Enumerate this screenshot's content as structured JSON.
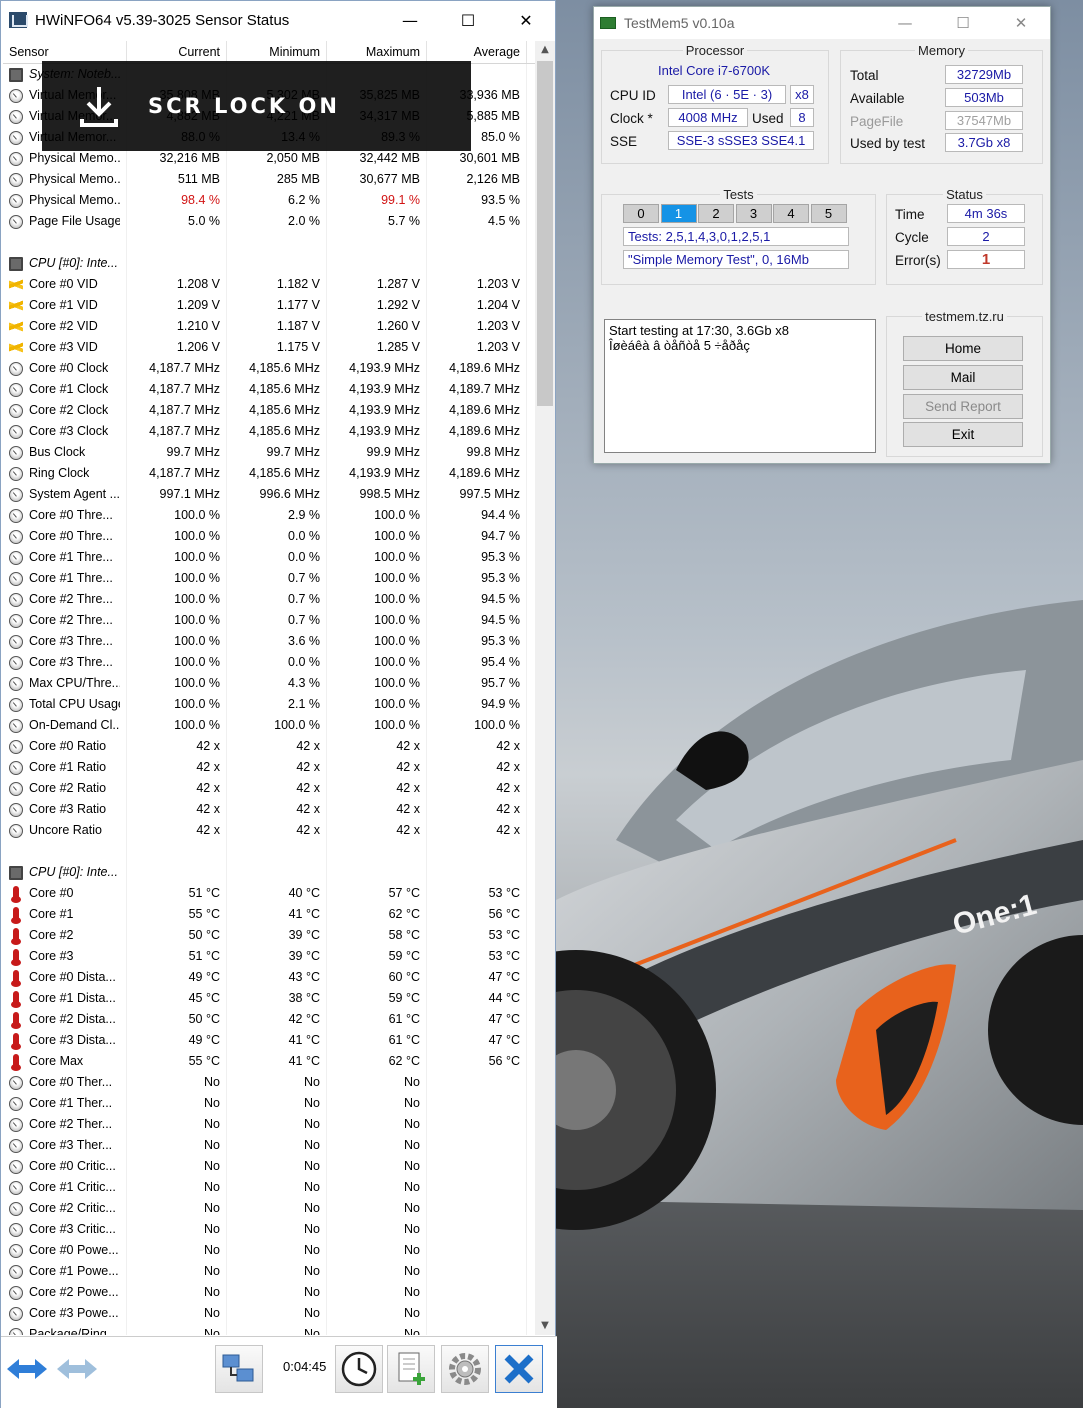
{
  "hwinfo": {
    "title": "HWiNFO64 v5.39-3025 Sensor Status",
    "window_buttons": {
      "minimize": "—",
      "maximize": "☐",
      "close": "✕"
    },
    "columns": [
      "Sensor",
      "Current",
      "Minimum",
      "Maximum",
      "Average"
    ],
    "rows": [
      {
        "icon": "chip",
        "type": "group",
        "name": "System: Noteb...",
        "cur": "",
        "min": "",
        "max": "",
        "avg": ""
      },
      {
        "icon": "gauge",
        "name": "Virtual Memor...",
        "cur": "35,808 MB",
        "min": "5,302 MB",
        "max": "35,825 MB",
        "avg": "33,936 MB"
      },
      {
        "icon": "gauge",
        "name": "Virtual Memor...",
        "cur": "4,882 MB",
        "min": "4,221 MB",
        "max": "34,317 MB",
        "avg": "5,885 MB"
      },
      {
        "icon": "gauge",
        "name": "Virtual Memor...",
        "cur": "88.0 %",
        "min": "13.4 %",
        "max": "89.3 %",
        "avg": "85.0 %"
      },
      {
        "icon": "gauge",
        "name": "Physical Memo...",
        "cur": "32,216 MB",
        "min": "2,050 MB",
        "max": "32,442 MB",
        "avg": "30,601 MB"
      },
      {
        "icon": "gauge",
        "name": "Physical Memo...",
        "cur": "511 MB",
        "min": "285 MB",
        "max": "30,677 MB",
        "avg": "2,126 MB"
      },
      {
        "icon": "gauge",
        "name": "Physical Memo...",
        "cur": "98.4 %",
        "min": "6.2 %",
        "max": "99.1 %",
        "avg": "93.5 %",
        "alert_cur": true,
        "alert_max": true
      },
      {
        "icon": "gauge",
        "name": "Page File Usage",
        "cur": "5.0 %",
        "min": "2.0 %",
        "max": "5.7 %",
        "avg": "4.5 %"
      },
      {
        "icon": "none",
        "type": "blank",
        "name": "",
        "cur": "",
        "min": "",
        "max": "",
        "avg": ""
      },
      {
        "icon": "chip",
        "type": "group",
        "name": "CPU [#0]: Inte...",
        "cur": "",
        "min": "",
        "max": "",
        "avg": ""
      },
      {
        "icon": "bolt",
        "name": "Core #0 VID",
        "cur": "1.208 V",
        "min": "1.182 V",
        "max": "1.287 V",
        "avg": "1.203 V"
      },
      {
        "icon": "bolt",
        "name": "Core #1 VID",
        "cur": "1.209 V",
        "min": "1.177 V",
        "max": "1.292 V",
        "avg": "1.204 V"
      },
      {
        "icon": "bolt",
        "name": "Core #2 VID",
        "cur": "1.210 V",
        "min": "1.187 V",
        "max": "1.260 V",
        "avg": "1.203 V"
      },
      {
        "icon": "bolt",
        "name": "Core #3 VID",
        "cur": "1.206 V",
        "min": "1.175 V",
        "max": "1.285 V",
        "avg": "1.203 V"
      },
      {
        "icon": "gauge",
        "name": "Core #0 Clock",
        "cur": "4,187.7 MHz",
        "min": "4,185.6 MHz",
        "max": "4,193.9 MHz",
        "avg": "4,189.6 MHz"
      },
      {
        "icon": "gauge",
        "name": "Core #1 Clock",
        "cur": "4,187.7 MHz",
        "min": "4,185.6 MHz",
        "max": "4,193.9 MHz",
        "avg": "4,189.7 MHz"
      },
      {
        "icon": "gauge",
        "name": "Core #2 Clock",
        "cur": "4,187.7 MHz",
        "min": "4,185.6 MHz",
        "max": "4,193.9 MHz",
        "avg": "4,189.6 MHz"
      },
      {
        "icon": "gauge",
        "name": "Core #3 Clock",
        "cur": "4,187.7 MHz",
        "min": "4,185.6 MHz",
        "max": "4,193.9 MHz",
        "avg": "4,189.6 MHz"
      },
      {
        "icon": "gauge",
        "name": "Bus Clock",
        "cur": "99.7 MHz",
        "min": "99.7 MHz",
        "max": "99.9 MHz",
        "avg": "99.8 MHz"
      },
      {
        "icon": "gauge",
        "name": "Ring Clock",
        "cur": "4,187.7 MHz",
        "min": "4,185.6 MHz",
        "max": "4,193.9 MHz",
        "avg": "4,189.6 MHz"
      },
      {
        "icon": "gauge",
        "name": "System Agent ...",
        "cur": "997.1 MHz",
        "min": "996.6 MHz",
        "max": "998.5 MHz",
        "avg": "997.5 MHz"
      },
      {
        "icon": "gauge",
        "name": "Core #0 Thre...",
        "cur": "100.0 %",
        "min": "2.9 %",
        "max": "100.0 %",
        "avg": "94.4 %"
      },
      {
        "icon": "gauge",
        "name": "Core #0 Thre...",
        "cur": "100.0 %",
        "min": "0.0 %",
        "max": "100.0 %",
        "avg": "94.7 %"
      },
      {
        "icon": "gauge",
        "name": "Core #1 Thre...",
        "cur": "100.0 %",
        "min": "0.0 %",
        "max": "100.0 %",
        "avg": "95.3 %"
      },
      {
        "icon": "gauge",
        "name": "Core #1 Thre...",
        "cur": "100.0 %",
        "min": "0.7 %",
        "max": "100.0 %",
        "avg": "95.3 %"
      },
      {
        "icon": "gauge",
        "name": "Core #2 Thre...",
        "cur": "100.0 %",
        "min": "0.7 %",
        "max": "100.0 %",
        "avg": "94.5 %"
      },
      {
        "icon": "gauge",
        "name": "Core #2 Thre...",
        "cur": "100.0 %",
        "min": "0.7 %",
        "max": "100.0 %",
        "avg": "94.5 %"
      },
      {
        "icon": "gauge",
        "name": "Core #3 Thre...",
        "cur": "100.0 %",
        "min": "3.6 %",
        "max": "100.0 %",
        "avg": "95.3 %"
      },
      {
        "icon": "gauge",
        "name": "Core #3 Thre...",
        "cur": "100.0 %",
        "min": "0.0 %",
        "max": "100.0 %",
        "avg": "95.4 %"
      },
      {
        "icon": "gauge",
        "name": "Max CPU/Thre...",
        "cur": "100.0 %",
        "min": "4.3 %",
        "max": "100.0 %",
        "avg": "95.7 %"
      },
      {
        "icon": "gauge",
        "name": "Total CPU Usage",
        "cur": "100.0 %",
        "min": "2.1 %",
        "max": "100.0 %",
        "avg": "94.9 %"
      },
      {
        "icon": "gauge",
        "name": "On-Demand Cl...",
        "cur": "100.0 %",
        "min": "100.0 %",
        "max": "100.0 %",
        "avg": "100.0 %"
      },
      {
        "icon": "gauge",
        "name": "Core #0 Ratio",
        "cur": "42 x",
        "min": "42 x",
        "max": "42 x",
        "avg": "42 x"
      },
      {
        "icon": "gauge",
        "name": "Core #1 Ratio",
        "cur": "42 x",
        "min": "42 x",
        "max": "42 x",
        "avg": "42 x"
      },
      {
        "icon": "gauge",
        "name": "Core #2 Ratio",
        "cur": "42 x",
        "min": "42 x",
        "max": "42 x",
        "avg": "42 x"
      },
      {
        "icon": "gauge",
        "name": "Core #3 Ratio",
        "cur": "42 x",
        "min": "42 x",
        "max": "42 x",
        "avg": "42 x"
      },
      {
        "icon": "gauge",
        "name": "Uncore Ratio",
        "cur": "42 x",
        "min": "42 x",
        "max": "42 x",
        "avg": "42 x"
      },
      {
        "icon": "none",
        "type": "blank",
        "name": "",
        "cur": "",
        "min": "",
        "max": "",
        "avg": ""
      },
      {
        "icon": "chip",
        "type": "group",
        "name": "CPU [#0]: Inte...",
        "cur": "",
        "min": "",
        "max": "",
        "avg": ""
      },
      {
        "icon": "therm",
        "name": "Core #0",
        "cur": "51 °C",
        "min": "40 °C",
        "max": "57 °C",
        "avg": "53 °C"
      },
      {
        "icon": "therm",
        "name": "Core #1",
        "cur": "55 °C",
        "min": "41 °C",
        "max": "62 °C",
        "avg": "56 °C"
      },
      {
        "icon": "therm",
        "name": "Core #2",
        "cur": "50 °C",
        "min": "39 °C",
        "max": "58 °C",
        "avg": "53 °C"
      },
      {
        "icon": "therm",
        "name": "Core #3",
        "cur": "51 °C",
        "min": "39 °C",
        "max": "59 °C",
        "avg": "53 °C"
      },
      {
        "icon": "therm",
        "name": "Core #0 Dista...",
        "cur": "49 °C",
        "min": "43 °C",
        "max": "60 °C",
        "avg": "47 °C"
      },
      {
        "icon": "therm",
        "name": "Core #1 Dista...",
        "cur": "45 °C",
        "min": "38 °C",
        "max": "59 °C",
        "avg": "44 °C"
      },
      {
        "icon": "therm",
        "name": "Core #2 Dista...",
        "cur": "50 °C",
        "min": "42 °C",
        "max": "61 °C",
        "avg": "47 °C"
      },
      {
        "icon": "therm",
        "name": "Core #3 Dista...",
        "cur": "49 °C",
        "min": "41 °C",
        "max": "61 °C",
        "avg": "47 °C"
      },
      {
        "icon": "therm",
        "name": "Core Max",
        "cur": "55 °C",
        "min": "41 °C",
        "max": "62 °C",
        "avg": "56 °C"
      },
      {
        "icon": "gauge",
        "name": "Core #0 Ther...",
        "cur": "No",
        "min": "No",
        "max": "No",
        "avg": ""
      },
      {
        "icon": "gauge",
        "name": "Core #1 Ther...",
        "cur": "No",
        "min": "No",
        "max": "No",
        "avg": ""
      },
      {
        "icon": "gauge",
        "name": "Core #2 Ther...",
        "cur": "No",
        "min": "No",
        "max": "No",
        "avg": ""
      },
      {
        "icon": "gauge",
        "name": "Core #3 Ther...",
        "cur": "No",
        "min": "No",
        "max": "No",
        "avg": ""
      },
      {
        "icon": "gauge",
        "name": "Core #0 Critic...",
        "cur": "No",
        "min": "No",
        "max": "No",
        "avg": ""
      },
      {
        "icon": "gauge",
        "name": "Core #1 Critic...",
        "cur": "No",
        "min": "No",
        "max": "No",
        "avg": ""
      },
      {
        "icon": "gauge",
        "name": "Core #2 Critic...",
        "cur": "No",
        "min": "No",
        "max": "No",
        "avg": ""
      },
      {
        "icon": "gauge",
        "name": "Core #3 Critic...",
        "cur": "No",
        "min": "No",
        "max": "No",
        "avg": ""
      },
      {
        "icon": "gauge",
        "name": "Core #0 Powe...",
        "cur": "No",
        "min": "No",
        "max": "No",
        "avg": ""
      },
      {
        "icon": "gauge",
        "name": "Core #1 Powe...",
        "cur": "No",
        "min": "No",
        "max": "No",
        "avg": ""
      },
      {
        "icon": "gauge",
        "name": "Core #2 Powe...",
        "cur": "No",
        "min": "No",
        "max": "No",
        "avg": ""
      },
      {
        "icon": "gauge",
        "name": "Core #3 Powe...",
        "cur": "No",
        "min": "No",
        "max": "No",
        "avg": ""
      },
      {
        "icon": "gauge",
        "name": "Package/Ring...",
        "cur": "No",
        "min": "No",
        "max": "No",
        "avg": ""
      }
    ],
    "alert_color": "#d21414",
    "toolbar": {
      "elapsed_time": "0:04:45",
      "buttons": [
        "nav-arrows-icon",
        "nav-arrows-disabled-icon",
        "network-icon",
        "clock-icon",
        "report-add-icon",
        "gear-icon",
        "close-x-icon"
      ]
    }
  },
  "overlay": {
    "text": "SCR LOCK ON",
    "icon": "download-arrow-icon"
  },
  "testmem": {
    "title": "TestMem5 v0.10a",
    "window_buttons": {
      "minimize": "—",
      "maximize": "☐",
      "close": "✕"
    },
    "processor": {
      "legend": "Processor",
      "name": "Intel Core i7-6700K",
      "cpu_id_label": "CPU ID",
      "cpu_id_value": "Intel (6 · 5E · 3)",
      "cpu_id_threads": "x8",
      "clock_label": "Clock *",
      "clock_value": "4008 MHz",
      "used_label": "Used",
      "used_value": "8",
      "sse_label": "SSE",
      "sse_value": "SSE-3 sSSE3 SSE4.1"
    },
    "memory": {
      "legend": "Memory",
      "total_label": "Total",
      "total_value": "32729Mb",
      "available_label": "Available",
      "available_value": "503Mb",
      "pagefile_label": "PageFile",
      "pagefile_value": "37547Mb",
      "used_label": "Used by test",
      "used_value": "3.7Gb x8"
    },
    "tests": {
      "legend": "Tests",
      "cells": [
        "0",
        "1",
        "2",
        "3",
        "4",
        "5"
      ],
      "active_cell": "1",
      "sequence": "Tests: 2,5,1,4,3,0,1,2,5,1",
      "current": "\"Simple Memory Test\", 0, 16Mb",
      "active_color": "#1593e6"
    },
    "status": {
      "legend": "Status",
      "time_label": "Time",
      "time_value": "4m 36s",
      "cycle_label": "Cycle",
      "cycle_value": "2",
      "errors_label": "Error(s)",
      "errors_value": "1",
      "error_color": "#c0392b"
    },
    "log_lines": [
      "Start testing at 17:30, 3.6Gb x8",
      "Îøèáêà â òåñòå 5 ÷åðåç"
    ],
    "links": {
      "legend": "testmem.tz.ru",
      "home": "Home",
      "mail": "Mail",
      "send_report": "Send Report",
      "exit": "Exit"
    }
  },
  "desktop": {
    "car_badge": "One:1",
    "accent_color": "#e8621c"
  }
}
